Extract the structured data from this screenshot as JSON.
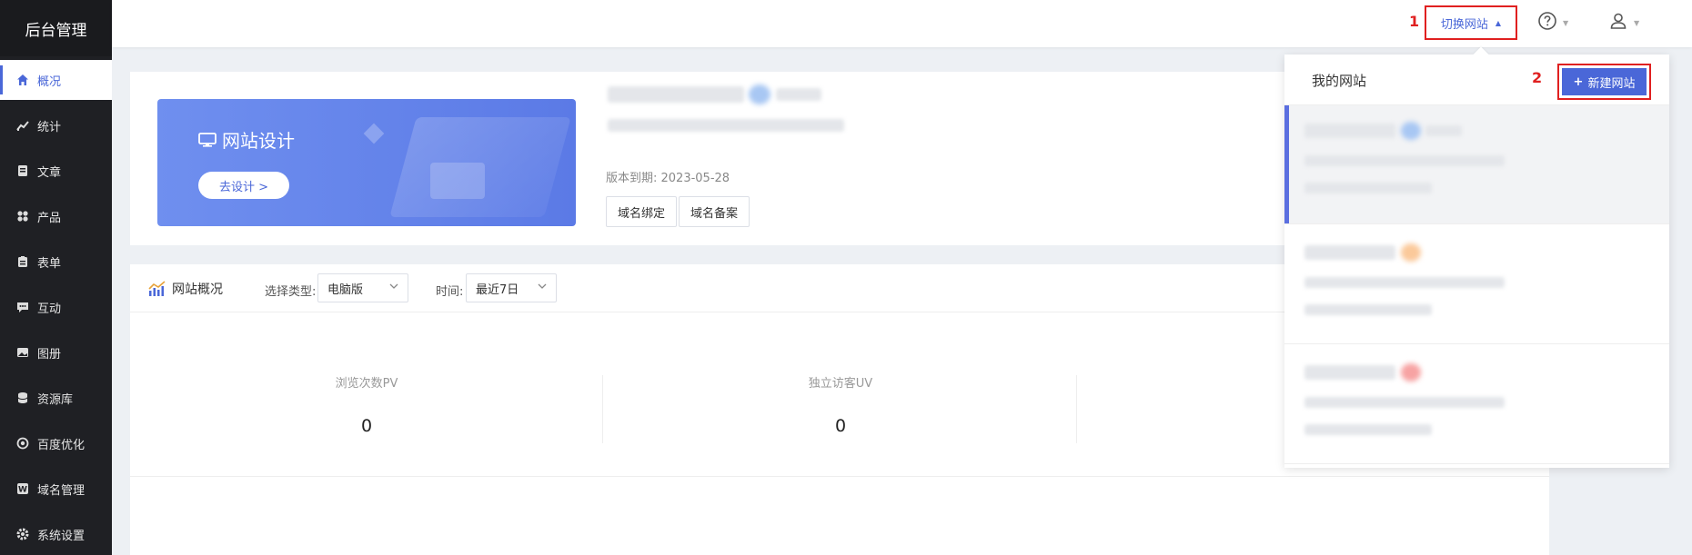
{
  "sidebar": {
    "brand": "后台管理",
    "items": [
      {
        "label": "概况",
        "icon": "home-icon",
        "active": true
      },
      {
        "label": "统计",
        "icon": "stats-icon"
      },
      {
        "label": "文章",
        "icon": "article-icon"
      },
      {
        "label": "产品",
        "icon": "product-icon"
      },
      {
        "label": "表单",
        "icon": "form-icon"
      },
      {
        "label": "互动",
        "icon": "chat-icon"
      },
      {
        "label": "图册",
        "icon": "gallery-icon"
      },
      {
        "label": "资源库",
        "icon": "database-icon"
      },
      {
        "label": "百度优化",
        "icon": "seo-icon"
      },
      {
        "label": "域名管理",
        "icon": "domain-icon"
      },
      {
        "label": "系统设置",
        "icon": "settings-icon"
      }
    ]
  },
  "topbar": {
    "switch_site": "切换网站",
    "marker_1": "1",
    "marker_2": "2"
  },
  "banner": {
    "title": "网站设计",
    "button": "去设计 >"
  },
  "site_info": {
    "expire": "版本到期: 2023-05-28",
    "bind_domain": "域名绑定",
    "record_domain": "域名备案"
  },
  "overview": {
    "title": "网站概况",
    "type_label": "选择类型:",
    "type_value": "电脑版",
    "time_label": "时间:",
    "time_value": "最近7日",
    "stats": [
      {
        "label": "浏览次数PV",
        "value": "0"
      },
      {
        "label": "独立访客UV",
        "value": "0"
      }
    ]
  },
  "dropdown": {
    "title": "我的网站",
    "new_button": "新建网站"
  },
  "colors": {
    "accent": "#4a67d8",
    "sidebar_bg": "#1f2024",
    "highlight_red": "#e02020"
  }
}
